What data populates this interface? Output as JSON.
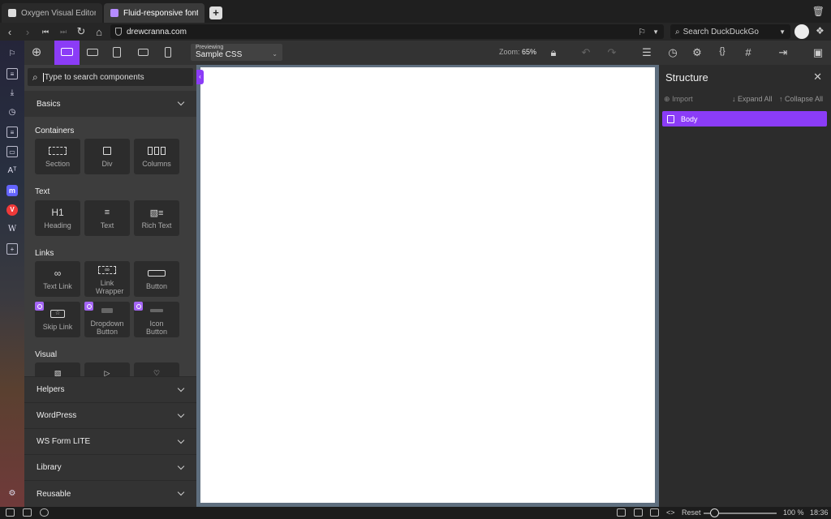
{
  "browser": {
    "tabs": [
      {
        "label": "Oxygen Visual Editor - Sample CSS",
        "active": false
      },
      {
        "label": "Fluid-responsive font-size",
        "active": true
      }
    ],
    "url": "drewcranna.com",
    "search_placeholder": "Search DuckDuckGo"
  },
  "toolbar": {
    "previewing_label": "Previewing",
    "previewing_value": "Sample CSS",
    "zoom_label": "Zoom:",
    "zoom_value": "65%"
  },
  "components": {
    "search_placeholder": "Type to search components",
    "basics_label": "Basics",
    "groups": {
      "containers": {
        "title": "Containers",
        "items": [
          "Section",
          "Div",
          "Columns"
        ]
      },
      "text": {
        "title": "Text",
        "items": [
          "Heading",
          "Text",
          "Rich Text"
        ]
      },
      "links": {
        "title": "Links",
        "items": [
          "Text Link",
          "Link Wrapper",
          "Button",
          "Skip Link",
          "Dropdown Button",
          "Icon Button"
        ]
      },
      "visual": {
        "title": "Visual"
      }
    },
    "heading_glyph": "H1",
    "accordions": [
      "Helpers",
      "WordPress",
      "WS Form LITE",
      "Library",
      "Reusable"
    ]
  },
  "structure": {
    "title": "Structure",
    "import_label": "Import",
    "expand_label": "Expand All",
    "collapse_label": "Collapse All",
    "body_label": "Body"
  },
  "statusbar": {
    "reset_label": "Reset",
    "zoom_value": "100 %",
    "time": "18:36",
    "zoom_slider": 0.15
  },
  "colors": {
    "accent": "#8b3cf7"
  }
}
